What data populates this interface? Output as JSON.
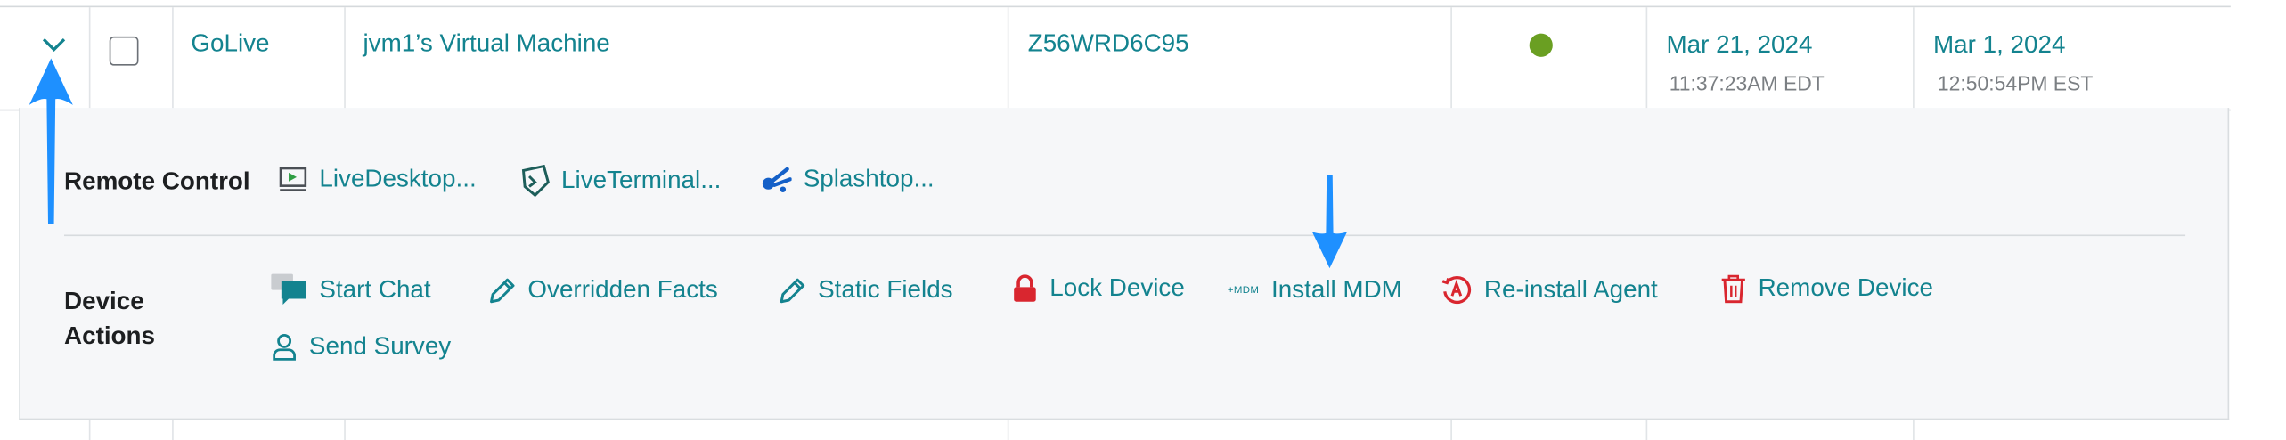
{
  "row": {
    "name": "GoLive",
    "device": "jvm1’s Virtual Machine",
    "serial": "Z56WRD6C95",
    "status_color": "#6a9f22",
    "date1": "Mar 21, 2024",
    "time1": "11:37:23AM EDT",
    "date2": "Mar 1, 2024",
    "time2": "12:50:54PM EST"
  },
  "remote_control": {
    "label": "Remote Control",
    "items": [
      {
        "label": "LiveDesktop...",
        "icon": "live-desktop-icon"
      },
      {
        "label": "LiveTerminal...",
        "icon": "live-terminal-icon"
      },
      {
        "label": "Splashtop...",
        "icon": "splashtop-icon"
      }
    ]
  },
  "device_actions": {
    "label_line1": "Device",
    "label_line2": "Actions",
    "items": [
      {
        "label": "Start Chat",
        "icon": "chat-icon"
      },
      {
        "label": "Overridden Facts",
        "icon": "pencil-icon"
      },
      {
        "label": "Static Fields",
        "icon": "pencil-icon"
      },
      {
        "label": "Lock Device",
        "icon": "lock-icon",
        "icon_color": "#d9262f"
      },
      {
        "label": "Install MDM",
        "icon": "mdm-icon",
        "badge": "+MDM"
      },
      {
        "label": "Re-install Agent",
        "icon": "reinstall-agent-icon",
        "icon_color": "#d9262f"
      },
      {
        "label": "Remove Device",
        "icon": "trash-icon",
        "icon_color": "#d9262f"
      },
      {
        "label": "Send Survey",
        "icon": "person-icon"
      }
    ]
  },
  "colors": {
    "accent": "#13838f",
    "annotation_arrow": "#1e90ff",
    "danger": "#d9262f"
  }
}
